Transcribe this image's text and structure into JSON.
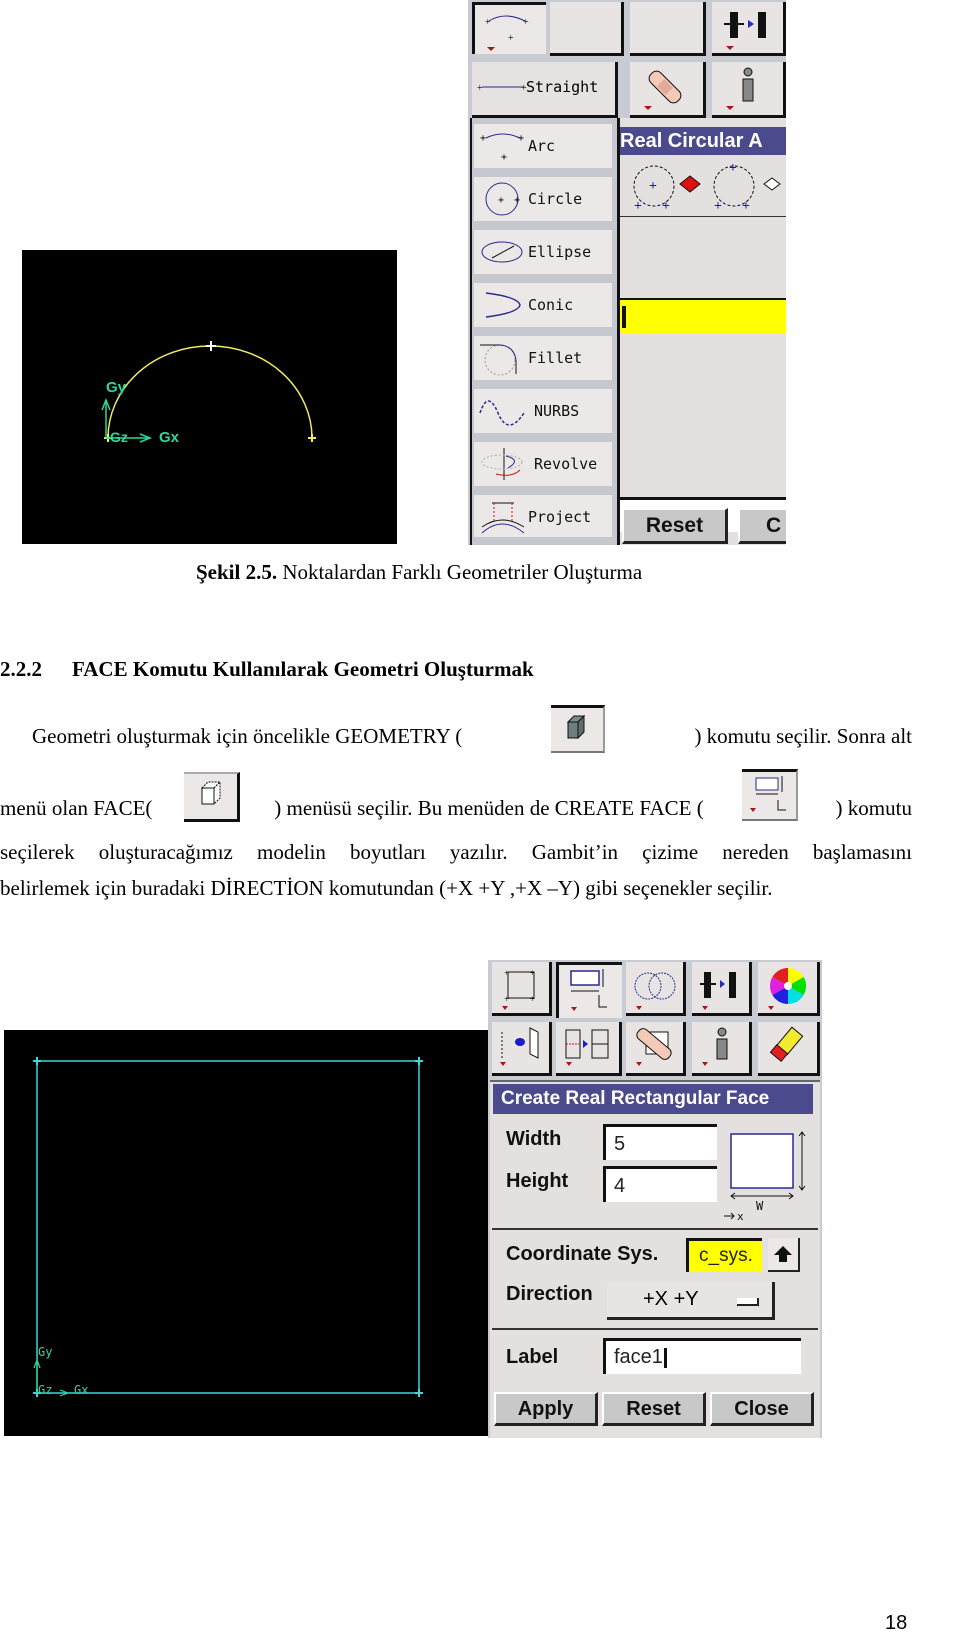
{
  "figure1": {
    "viewport": {
      "axis_labels": {
        "gy": "Gy",
        "gz": "Gz",
        "gx": "Gx"
      },
      "curve_color": "#f2ea62",
      "axis_color": "#2bd99b"
    },
    "menu": {
      "selected": "Straight",
      "items": [
        {
          "label": "Straight",
          "icon": "straight-line-icon"
        },
        {
          "label": "Arc",
          "icon": "arc-icon"
        },
        {
          "label": "Circle",
          "icon": "circle-icon"
        },
        {
          "label": "Ellipse",
          "icon": "ellipse-icon"
        },
        {
          "label": "Conic",
          "icon": "conic-icon"
        },
        {
          "label": "Fillet",
          "icon": "fillet-icon"
        },
        {
          "label": "NURBS",
          "icon": "nurbs-icon"
        },
        {
          "label": "Revolve",
          "icon": "revolve-icon"
        },
        {
          "label": "Project",
          "icon": "project-icon"
        }
      ]
    },
    "dialog": {
      "title": "Real Circular A",
      "reset_label": "Reset",
      "close_label_partial": "C"
    },
    "caption": {
      "number": "Şekil 2.5.",
      "text": " Noktalardan Farklı Geometriler Oluşturma"
    }
  },
  "section": {
    "number": "2.2.2",
    "title": "FACE Komutu Kullanılarak Geometri Oluşturmak"
  },
  "paragraph": {
    "line1_a": "Geometri oluşturmak için öncelikle GEOMETRY (",
    "line1_b": ") komutu seçilir. Sonra alt",
    "line2_a": "menü olan  FACE(",
    "line2_b": ") menüsü seçilir. Bu menüden de CREATE FACE (",
    "line2_c": ") komutu",
    "line3": "seçilerek oluşturacağımız modelin boyutları yazılır. Gambit’in çizime nereden başlamasını",
    "line4": "belirlemek için  buradaki DİRECTİON komutundan (+X +Y ,+X –Y) gibi seçenekler seçilir."
  },
  "figure2": {
    "viewport": {
      "axis_labels": {
        "gy": "Gy",
        "gz": "Gz",
        "gx": "Gx"
      },
      "rect_color": "#3fd6d6"
    },
    "dialog": {
      "title": "Create Real Rectangular Face",
      "width_label": "Width",
      "width_value": "5",
      "height_label": "Height",
      "height_value": "4",
      "preview_w_label": "W",
      "preview_x_label": "x",
      "coord_label": "Coordinate Sys.",
      "coord_value": "c_sys.",
      "direction_label": "Direction",
      "direction_value": "+X +Y",
      "label_label": "Label",
      "label_value": "face1",
      "apply_label": "Apply",
      "reset_label": "Reset",
      "close_label": "Close"
    }
  },
  "page_number": "18"
}
